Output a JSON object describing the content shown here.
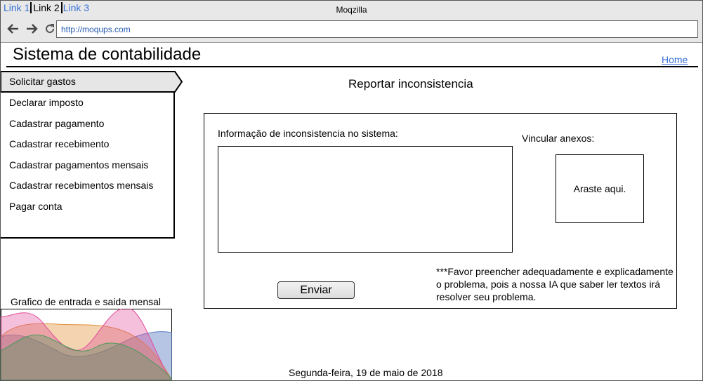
{
  "browser": {
    "tabs": [
      {
        "label": "Link 1",
        "active": false
      },
      {
        "label": "Link 2",
        "active": true
      },
      {
        "label": "Link 3",
        "active": false
      }
    ],
    "window_title": "Moqzilla",
    "url": "http://moqups.com",
    "nav_icons": [
      "back-arrow-icon",
      "forward-arrow-icon",
      "reload-icon"
    ]
  },
  "header": {
    "title": "Sistema de contabilidade",
    "home_link": "Home"
  },
  "sidebar": {
    "items": [
      {
        "label": "Solicitar gastos",
        "active": true
      },
      {
        "label": "Declarar imposto"
      },
      {
        "label": "Cadastrar pagamento"
      },
      {
        "label": "Cadastrar recebimento"
      },
      {
        "label": "Cadastrar pagamentos mensais"
      },
      {
        "label": "Cadastrar recebimentos mensais"
      },
      {
        "label": "Pagar conta"
      }
    ]
  },
  "main": {
    "title": "Reportar inconsistencia",
    "info_label": "Informação de inconsistencia no sistema:",
    "info_value": "",
    "attach_label": "Vincular anexos:",
    "dropzone_text": "Araste aqui.",
    "send_label": "Enviar",
    "note": "***Favor preencher adequadamente e explicadamente o problema, pois a nossa IA que saber ler textos irá resolver seu problema."
  },
  "chart": {
    "title": "Grafico de entrada e saida mensal",
    "colors": [
      "#e04a9a",
      "#e0903a",
      "#4a9a5a",
      "#5a7fc0"
    ]
  },
  "footer": {
    "date": "Segunda-feira, 19 de maio de 2018"
  }
}
